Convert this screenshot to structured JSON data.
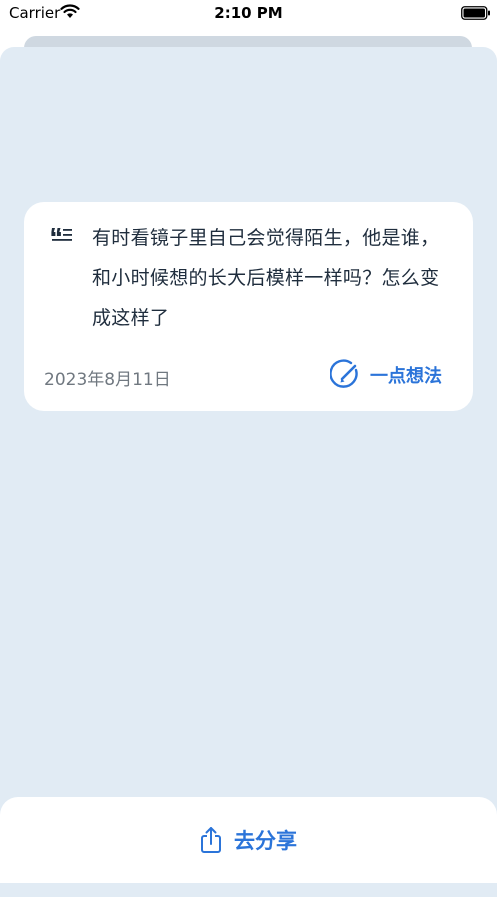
{
  "status_bar": {
    "carrier": "Carrier",
    "time": "2:10 PM",
    "wifi_icon": "wifi-icon",
    "battery_icon": "battery-icon"
  },
  "card": {
    "quote_icon": "quote-icon",
    "quote": "有时看镜子里自己会觉得陌生，他是谁，和小时候想的长大后模样一样吗？怎么变成这样了",
    "date": "2023年8月11日",
    "note_icon": "pen-circle-icon",
    "note_label": "一点想法"
  },
  "bottom": {
    "share_icon": "share-icon",
    "share_label": "去分享"
  },
  "colors": {
    "accent": "#2b74d9",
    "sheet_background": "#e1ebf4",
    "card_background": "#ffffff"
  }
}
